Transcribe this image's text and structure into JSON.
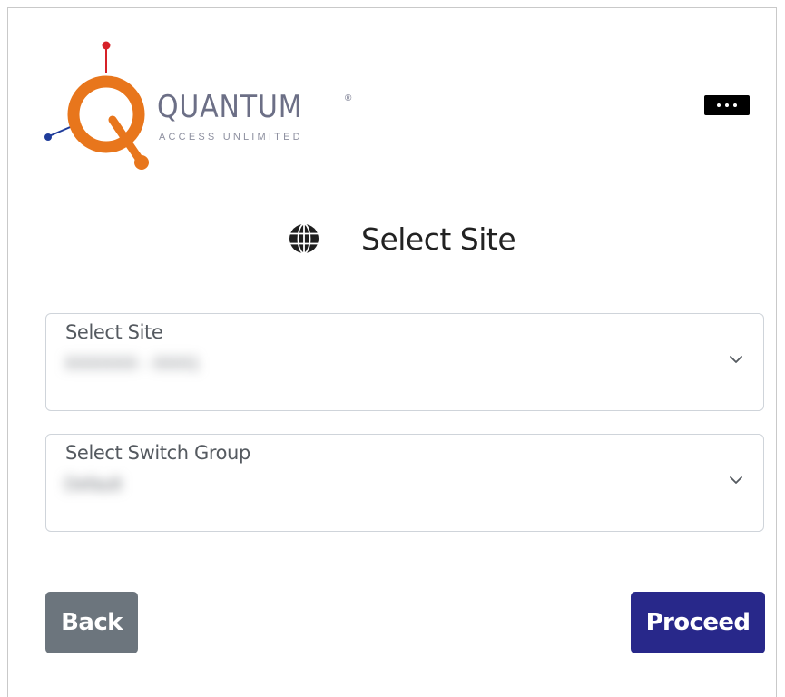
{
  "brand": {
    "name": "QUANTUM",
    "registered_mark": "®",
    "tagline": "ACCESS UNLIMITED",
    "logo_colors": {
      "ring": "#e8761c",
      "red_dot": "#d62128",
      "blue_dot": "#1f3c9a",
      "text": "#6c6f86"
    }
  },
  "header": {
    "menu_icon": "ellipsis-icon"
  },
  "page": {
    "title": "Select Site",
    "title_icon": "globe-icon"
  },
  "form": {
    "site": {
      "label": "Select Site",
      "value": "XXXXXX - XXX1",
      "value_obscured": true
    },
    "switch_group": {
      "label": "Select Switch Group",
      "value": "Default",
      "value_obscured": true
    }
  },
  "actions": {
    "back_label": "Back",
    "proceed_label": "Proceed",
    "back_color": "#6c757d",
    "proceed_color": "#28288a"
  }
}
